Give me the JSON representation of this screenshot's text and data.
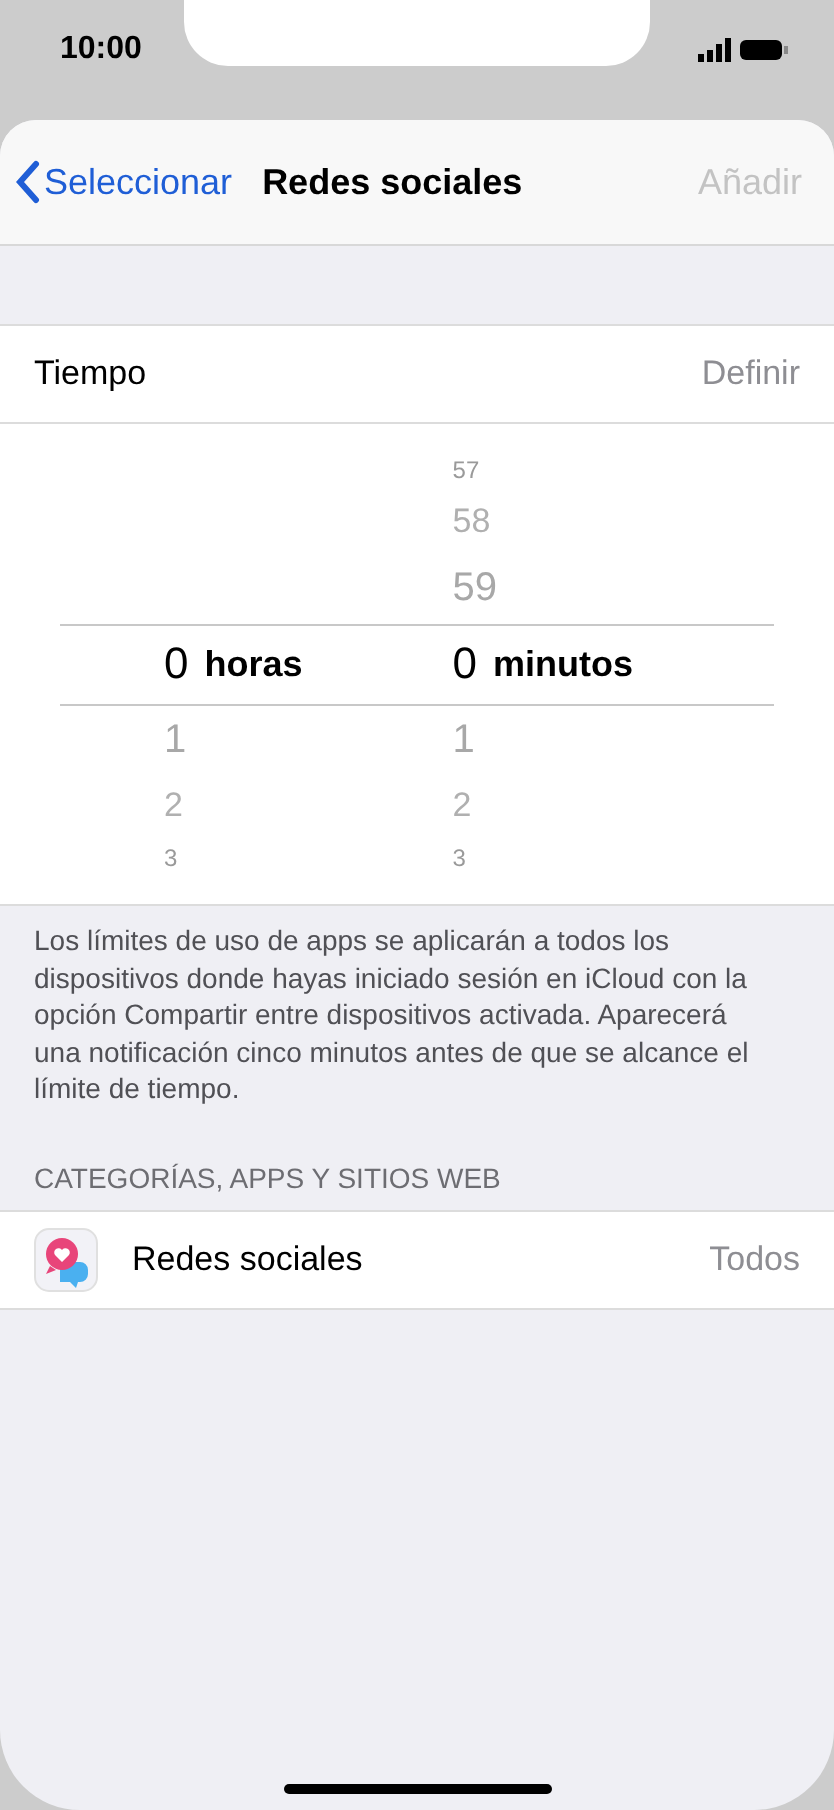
{
  "status_bar": {
    "time": "10:00"
  },
  "nav": {
    "back": "Seleccionar",
    "title": "Redes sociales",
    "action": {
      "label": "Añadir",
      "disabled": true
    }
  },
  "time_row": {
    "label": "Tiempo",
    "value": "Definir"
  },
  "picker": {
    "columns": [
      {
        "value": "0",
        "unit": "horas",
        "below": [
          "1",
          "2",
          "3"
        ]
      },
      {
        "above": [
          "57",
          "58",
          "59"
        ],
        "value": "0",
        "unit": "minutos",
        "below": [
          "1",
          "2",
          "3"
        ]
      }
    ]
  },
  "footer_note": "Los límites de uso de apps se aplicarán a todos los dispositivos donde hayas iniciado sesión en iCloud con la opción Compartir entre dispositivos activada. Aparecerá una notificación cinco minutos antes de que se alcance el límite de tiempo.",
  "section_header": "CATEGORÍAS, APPS Y SITIOS WEB",
  "items": [
    {
      "label": "Redes sociales",
      "value": "Todos"
    }
  ]
}
